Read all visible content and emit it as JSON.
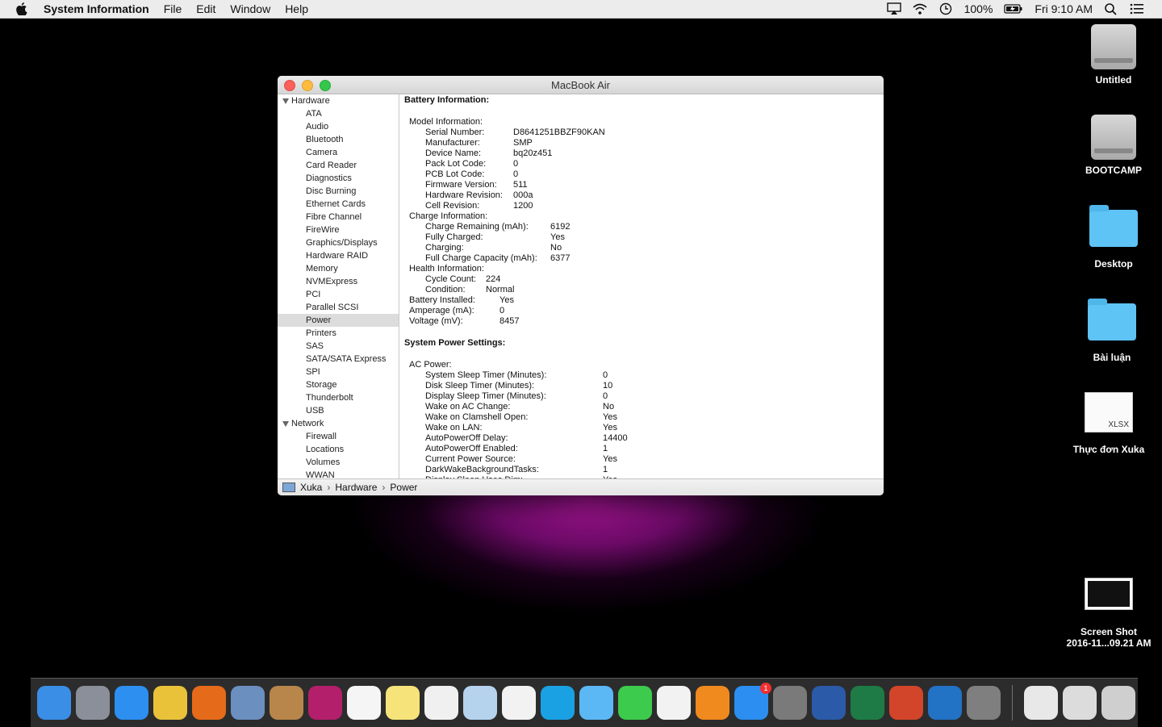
{
  "menubar": {
    "app_name": "System Information",
    "menus": [
      "File",
      "Edit",
      "Window",
      "Help"
    ],
    "battery": "100%",
    "clock": "Fri 9:10 AM"
  },
  "desktop": {
    "icons": [
      {
        "label": "Untitled",
        "kind": "disk"
      },
      {
        "label": "BOOTCAMP",
        "kind": "disk"
      },
      {
        "label": "Desktop",
        "kind": "folder"
      },
      {
        "label": "Bài luận",
        "kind": "folder"
      },
      {
        "label": "Thực đơn Xuka",
        "kind": "xlsx",
        "ext": "XLSX"
      },
      {
        "label": "Screen Shot",
        "label2": "2016-11...09.21 AM",
        "kind": "screenshot"
      }
    ]
  },
  "window": {
    "title": "MacBook Air",
    "sidebar": {
      "hardware_label": "Hardware",
      "hardware_items": [
        "ATA",
        "Audio",
        "Bluetooth",
        "Camera",
        "Card Reader",
        "Diagnostics",
        "Disc Burning",
        "Ethernet Cards",
        "Fibre Channel",
        "FireWire",
        "Graphics/Displays",
        "Hardware RAID",
        "Memory",
        "NVMExpress",
        "PCI",
        "Parallel SCSI",
        "Power",
        "Printers",
        "SAS",
        "SATA/SATA Express",
        "SPI",
        "Storage",
        "Thunderbolt",
        "USB"
      ],
      "selected": "Power",
      "network_label": "Network",
      "network_items": [
        "Firewall",
        "Locations",
        "Volumes",
        "WWAN"
      ]
    },
    "detail": {
      "battery_header": "Battery Information:",
      "model_header": "Model Information:",
      "model": [
        {
          "k": "Serial Number:",
          "v": "D8641251BBZF90KAN"
        },
        {
          "k": "Manufacturer:",
          "v": "SMP"
        },
        {
          "k": "Device Name:",
          "v": "bq20z451"
        },
        {
          "k": "Pack Lot Code:",
          "v": "0"
        },
        {
          "k": "PCB Lot Code:",
          "v": "0"
        },
        {
          "k": "Firmware Version:",
          "v": "511"
        },
        {
          "k": "Hardware Revision:",
          "v": "000a"
        },
        {
          "k": "Cell Revision:",
          "v": "1200"
        }
      ],
      "charge_header": "Charge Information:",
      "charge": [
        {
          "k": "Charge Remaining (mAh):",
          "v": "6192"
        },
        {
          "k": "Fully Charged:",
          "v": "Yes"
        },
        {
          "k": "Charging:",
          "v": "No"
        },
        {
          "k": "Full Charge Capacity (mAh):",
          "v": "6377"
        }
      ],
      "health_header": "Health Information:",
      "health": [
        {
          "k": "Cycle Count:",
          "v": "224"
        },
        {
          "k": "Condition:",
          "v": "Normal"
        }
      ],
      "misc": [
        {
          "k": "Battery Installed:",
          "v": "Yes"
        },
        {
          "k": "Amperage (mA):",
          "v": "0"
        },
        {
          "k": "Voltage (mV):",
          "v": "8457"
        }
      ],
      "power_header": "System Power Settings:",
      "ac_header": "AC Power:",
      "ac": [
        {
          "k": "System Sleep Timer (Minutes):",
          "v": "0"
        },
        {
          "k": "Disk Sleep Timer (Minutes):",
          "v": "10"
        },
        {
          "k": "Display Sleep Timer (Minutes):",
          "v": "0"
        },
        {
          "k": "Wake on AC Change:",
          "v": "No"
        },
        {
          "k": "Wake on Clamshell Open:",
          "v": "Yes"
        },
        {
          "k": "Wake on LAN:",
          "v": "Yes"
        },
        {
          "k": "AutoPowerOff Delay:",
          "v": "14400"
        },
        {
          "k": "AutoPowerOff Enabled:",
          "v": "1"
        },
        {
          "k": "Current Power Source:",
          "v": "Yes"
        },
        {
          "k": "DarkWakeBackgroundTasks:",
          "v": "1"
        },
        {
          "k": "Display Sleep Uses Dim:",
          "v": "Yes"
        }
      ]
    },
    "pathbar": [
      "Xuka",
      "Hardware",
      "Power"
    ]
  },
  "dock": {
    "apps": [
      {
        "name": "finder",
        "color": "#3a8ee6"
      },
      {
        "name": "launchpad",
        "color": "#8a8f99"
      },
      {
        "name": "safari",
        "color": "#2d8ff0"
      },
      {
        "name": "chrome",
        "color": "#e9c23a"
      },
      {
        "name": "firefox",
        "color": "#e56a1a"
      },
      {
        "name": "preview",
        "color": "#6b8fbf"
      },
      {
        "name": "contacts",
        "color": "#b8864b"
      },
      {
        "name": "photo-booth",
        "color": "#b31f6b"
      },
      {
        "name": "calendar",
        "color": "#f5f5f5"
      },
      {
        "name": "notes",
        "color": "#f6e37a"
      },
      {
        "name": "reminders",
        "color": "#f0f0f0"
      },
      {
        "name": "preview-2",
        "color": "#b6d3ee"
      },
      {
        "name": "photos",
        "color": "#f2f2f2"
      },
      {
        "name": "skype",
        "color": "#1aa1e4"
      },
      {
        "name": "messages",
        "color": "#5cb8f5"
      },
      {
        "name": "facetime",
        "color": "#3ccb4c"
      },
      {
        "name": "itunes",
        "color": "#f2f2f2"
      },
      {
        "name": "ibooks",
        "color": "#f08a1e"
      },
      {
        "name": "app-store",
        "color": "#2b8ef0",
        "badge": "1"
      },
      {
        "name": "system-preferences",
        "color": "#7a7a7a"
      },
      {
        "name": "word",
        "color": "#2b5aa8"
      },
      {
        "name": "excel",
        "color": "#1e7b45"
      },
      {
        "name": "powerpoint",
        "color": "#d2452a"
      },
      {
        "name": "outlook",
        "color": "#2272c6"
      },
      {
        "name": "archive-utility",
        "color": "#7f7f7f"
      }
    ],
    "right": [
      {
        "name": "documents",
        "color": "#e8e8e8"
      },
      {
        "name": "downloads",
        "color": "#dcdcdc"
      },
      {
        "name": "trash",
        "color": "#cfcfcf"
      }
    ]
  }
}
